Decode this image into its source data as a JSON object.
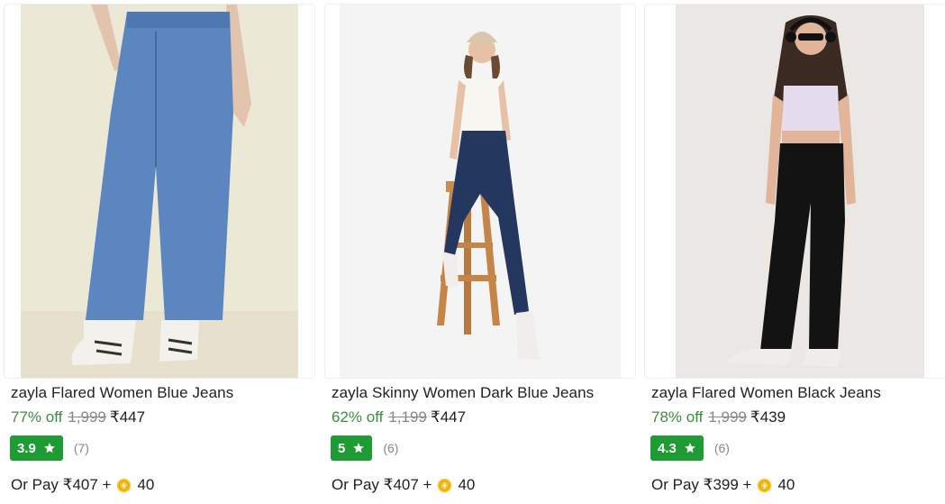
{
  "products": [
    {
      "title": "zayla Flared Women Blue Jeans",
      "discount": "77% off",
      "mrp": "1,999",
      "price": "₹447",
      "rating": "3.9",
      "rating_count": "(7)",
      "pay_prefix": "Or Pay ₹407 +",
      "coins": "40",
      "jeans_color": "#5b86bf"
    },
    {
      "title": "zayla Skinny Women Dark Blue Jeans",
      "discount": "62% off",
      "mrp": "1,199",
      "price": "₹447",
      "rating": "5",
      "rating_count": "(6)",
      "pay_prefix": "Or Pay ₹407 +",
      "coins": "40",
      "jeans_color": "#24375e"
    },
    {
      "title": "zayla Flared Women Black Jeans",
      "discount": "78% off",
      "mrp": "1,999",
      "price": "₹439",
      "rating": "4.3",
      "rating_count": "(6)",
      "pay_prefix": "Or Pay ₹399 +",
      "coins": "40",
      "jeans_color": "#131313"
    }
  ],
  "colors": {
    "discount_green": "#388e3c",
    "rating_green": "#1e9b32",
    "muted_gray": "#878787",
    "coin_yellow": "#f7c325"
  },
  "icons": {
    "rating": "star-icon",
    "coin": "supercoin-icon"
  }
}
